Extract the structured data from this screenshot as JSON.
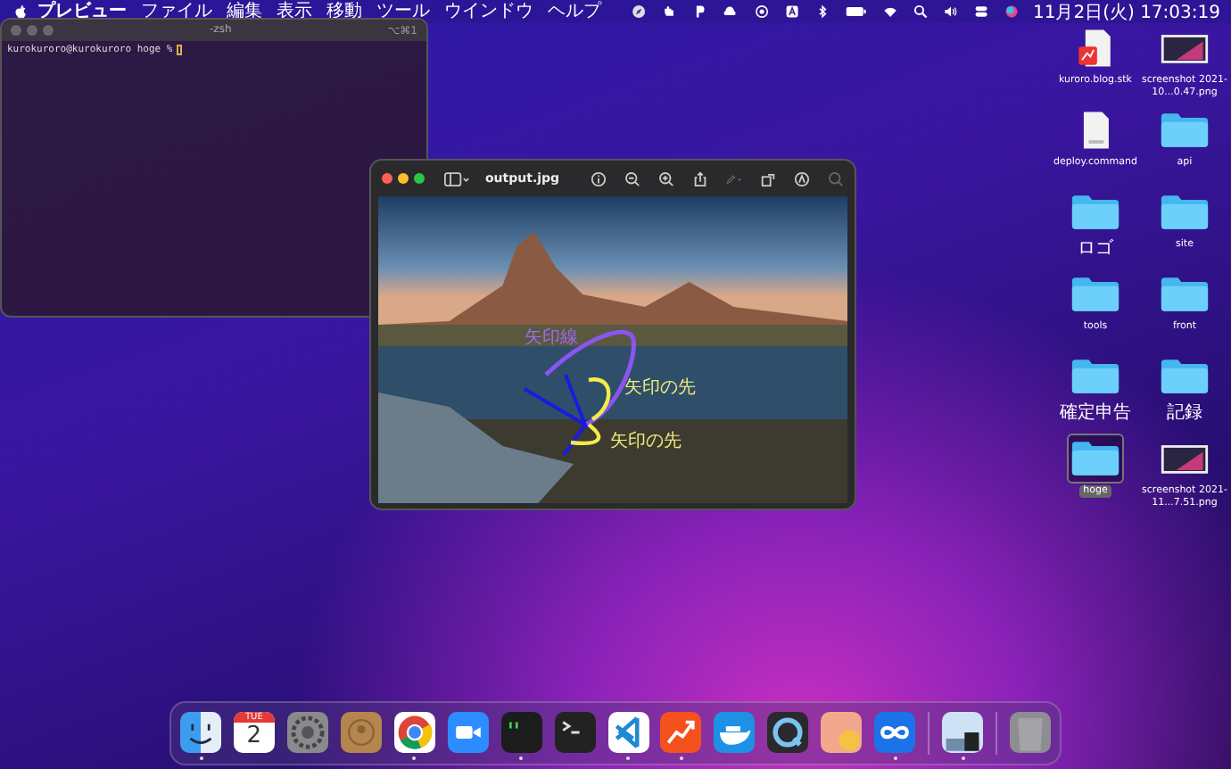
{
  "menu_bar": {
    "app_name": "プレビュー",
    "menus": [
      "ファイル",
      "編集",
      "表示",
      "移動",
      "ツール",
      "ウインドウ",
      "ヘルプ"
    ],
    "clock": "11月2日(火) 17:03:19"
  },
  "terminal": {
    "title": "-zsh",
    "shortcut": "⌥⌘1",
    "prompt": "kurokuroro@kurokuroro hoge %"
  },
  "preview": {
    "title": "output.jpg",
    "annotations": [
      {
        "kind": "line",
        "label": "矢印線"
      },
      {
        "kind": "arrowhead",
        "label": "矢印の先"
      },
      {
        "kind": "arrowhead",
        "label": "矢印の先"
      }
    ]
  },
  "desktop_icons": [
    {
      "kind": "document",
      "label": "kuroro.blog.stk",
      "selected": false
    },
    {
      "kind": "screenshot",
      "label": "screenshot 2021-10...0.47.png",
      "selected": false
    },
    {
      "kind": "script",
      "label": "deploy.command",
      "selected": false
    },
    {
      "kind": "folder",
      "label": "api",
      "selected": false
    },
    {
      "kind": "folder",
      "label": "ロゴ",
      "selected": false
    },
    {
      "kind": "folder",
      "label": "site",
      "selected": false
    },
    {
      "kind": "folder",
      "label": "tools",
      "selected": false
    },
    {
      "kind": "folder",
      "label": "front",
      "selected": false
    },
    {
      "kind": "folder",
      "label": "確定申告",
      "selected": false
    },
    {
      "kind": "folder",
      "label": "記録",
      "selected": false
    },
    {
      "kind": "folder",
      "label": "hoge",
      "selected": true
    },
    {
      "kind": "screenshot",
      "label": "screenshot 2021-11...7.51.png",
      "selected": false
    }
  ],
  "dock": {
    "calendar": {
      "weekday": "TUE",
      "day": "2"
    },
    "items": [
      {
        "kind": "finder",
        "running": true
      },
      {
        "kind": "calendar",
        "running": false
      },
      {
        "kind": "settings",
        "running": false
      },
      {
        "kind": "contacts",
        "running": false
      },
      {
        "kind": "chrome",
        "running": true
      },
      {
        "kind": "zoom",
        "running": false
      },
      {
        "kind": "iterm",
        "running": true
      },
      {
        "kind": "terminal",
        "running": false
      },
      {
        "kind": "vscode",
        "running": true
      },
      {
        "kind": "chart",
        "running": true
      },
      {
        "kind": "docker",
        "running": false
      },
      {
        "kind": "quicktime",
        "running": false
      },
      {
        "kind": "pill",
        "running": false
      },
      {
        "kind": "infinity",
        "running": true
      },
      {
        "kind": "separator"
      },
      {
        "kind": "stack",
        "running": true
      },
      {
        "kind": "separator"
      },
      {
        "kind": "trash",
        "running": false
      }
    ]
  }
}
